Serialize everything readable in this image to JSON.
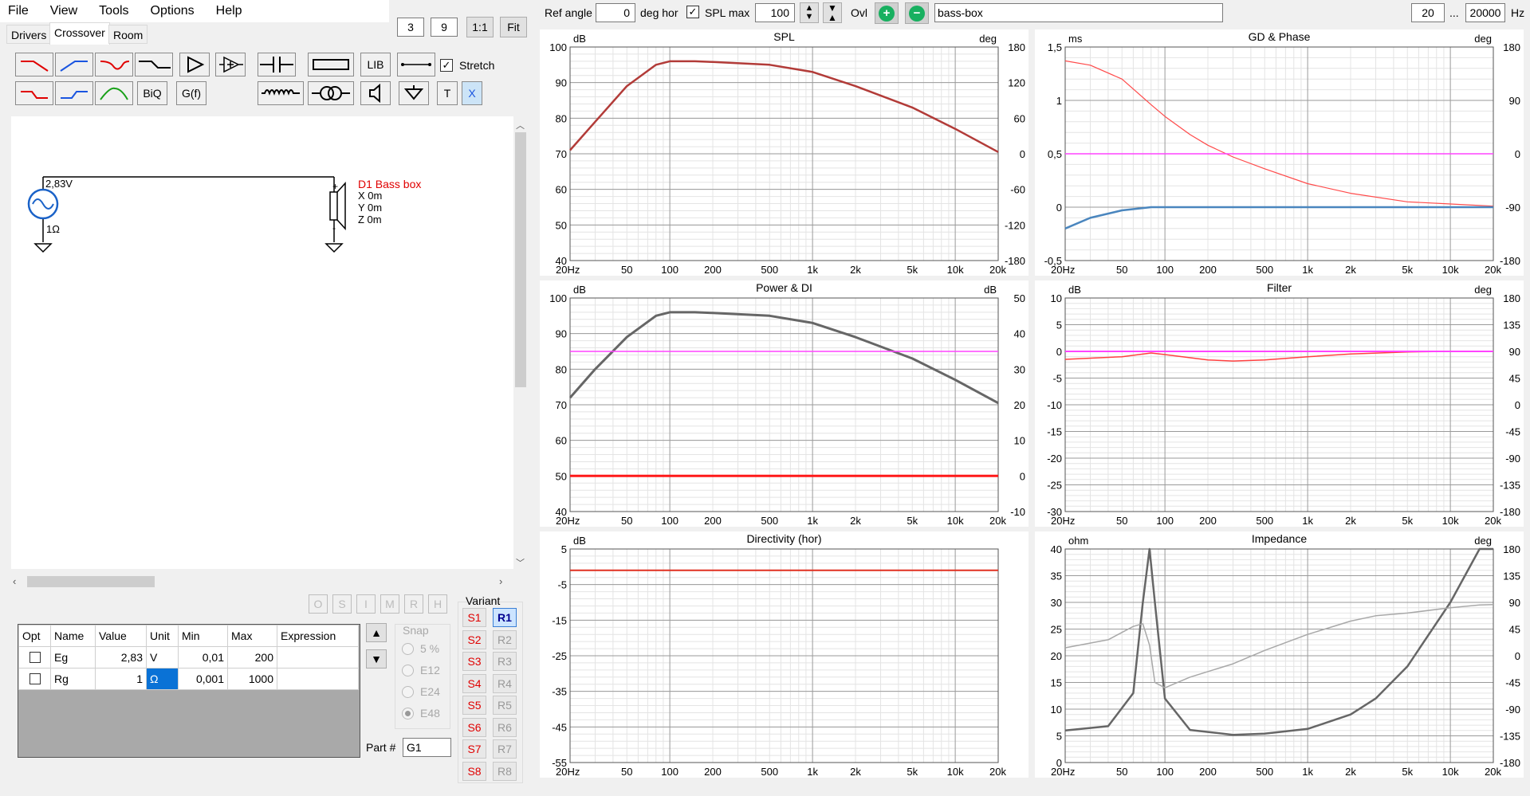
{
  "menu": [
    "File",
    "View",
    "Tools",
    "Options",
    "Help"
  ],
  "top": {
    "n1": "3",
    "n2": "9",
    "one": "1:1",
    "fit": "Fit"
  },
  "tabs": [
    "Drivers",
    "Crossover",
    "Room"
  ],
  "toolbar": {
    "lib": "LIB",
    "stretch": "Stretch",
    "biq": "BiQ",
    "gf": "G(f)",
    "t": "T",
    "x": "X"
  },
  "schematic": {
    "voltage": "2,83V",
    "resistance": "1Ω",
    "driver": "D1 Bass box",
    "x": "X 0m",
    "y": "Y 0m",
    "z": "Z 0m"
  },
  "graybtns": [
    "O",
    "S",
    "I",
    "M",
    "R",
    "H"
  ],
  "table": {
    "headers": [
      "Opt",
      "Name",
      "Value",
      "Unit",
      "Min",
      "Max",
      "Expression"
    ],
    "rows": [
      [
        "",
        "Eg",
        "2,83",
        "V",
        "0,01",
        "200",
        ""
      ],
      [
        "",
        "Rg",
        "1",
        "Ω",
        "0,001",
        "1000",
        ""
      ]
    ]
  },
  "snap": {
    "label": "Snap",
    "options": [
      "5 %",
      "E12",
      "E24",
      "E48"
    ]
  },
  "variant": {
    "label": "Variant",
    "s": [
      "S1",
      "S2",
      "S3",
      "S4",
      "S5",
      "S6",
      "S7",
      "S8"
    ],
    "r": [
      "R1",
      "R2",
      "R3",
      "R4",
      "R5",
      "R6",
      "R7",
      "R8"
    ]
  },
  "part": {
    "label": "Part #",
    "value": "G1"
  },
  "hdr": {
    "ref_label": "Ref angle",
    "ref_value": "0",
    "deg_hor": "deg hor",
    "spl_max_label": "SPL max",
    "spl_max_value": "100",
    "ovl": "Ovl",
    "name": "bass-box",
    "f_min": "20",
    "dots": "...",
    "f_max": "20000",
    "hz": "Hz"
  },
  "xticks": [
    "20Hz",
    "50",
    "100",
    "200",
    "500",
    "1k",
    "2k",
    "5k",
    "10k",
    "20k"
  ],
  "charts": {
    "spl": {
      "title": "SPL",
      "lunit": "dB",
      "runit": "deg",
      "ly": [
        "100",
        "90",
        "80",
        "70",
        "60",
        "50",
        "40"
      ],
      "ry": [
        "180",
        "120",
        "60",
        "0",
        "-60",
        "-120",
        "-180"
      ]
    },
    "gd": {
      "title": "GD & Phase",
      "lunit": "ms",
      "runit": "deg",
      "ly": [
        "1,5",
        "1",
        "0,5",
        "0",
        "-0,5"
      ],
      "ry": [
        "180",
        "90",
        "0",
        "-90",
        "-180"
      ]
    },
    "power": {
      "title": "Power & DI",
      "lunit": "dB",
      "runit": "dB",
      "ly": [
        "100",
        "90",
        "80",
        "70",
        "60",
        "50",
        "40"
      ],
      "ry": [
        "50",
        "40",
        "30",
        "20",
        "10",
        "0",
        "-10"
      ]
    },
    "filter": {
      "title": "Filter",
      "lunit": "dB",
      "runit": "deg",
      "ly": [
        "10",
        "5",
        "0",
        "-5",
        "-10",
        "-15",
        "-20",
        "-25",
        "-30"
      ],
      "ry": [
        "180",
        "135",
        "90",
        "45",
        "0",
        "-45",
        "-90",
        "-135",
        "-180"
      ]
    },
    "dir": {
      "title": "Directivity (hor)",
      "lunit": "dB",
      "runit": "",
      "ly": [
        "5",
        "-5",
        "-15",
        "-25",
        "-35",
        "-45",
        "-55"
      ],
      "ry": []
    },
    "imp": {
      "title": "Impedance",
      "lunit": "ohm",
      "runit": "deg",
      "ly": [
        "40",
        "35",
        "30",
        "25",
        "20",
        "15",
        "10",
        "5",
        "0"
      ],
      "ry": [
        "180",
        "135",
        "90",
        "45",
        "0",
        "-45",
        "-90",
        "-135",
        "-180"
      ]
    }
  },
  "chart_data": [
    {
      "type": "line",
      "title": "SPL",
      "x": [
        20,
        30,
        50,
        80,
        100,
        150,
        200,
        500,
        1000,
        2000,
        5000,
        10000,
        20000
      ],
      "series": [
        {
          "values": [
            71,
            79,
            89,
            95,
            96,
            96,
            95.8,
            95,
            93,
            89,
            83,
            77,
            70.5
          ]
        }
      ],
      "xlim": [
        20,
        20000
      ],
      "ylim": [
        40,
        100
      ],
      "xscale": "log"
    },
    {
      "type": "line",
      "title": "GD & Phase",
      "x": [
        20,
        30,
        50,
        80,
        100,
        150,
        200,
        300,
        500,
        1000,
        2000,
        5000,
        10000,
        20000
      ],
      "series": [
        {
          "values": [
            1.37,
            1.33,
            1.2,
            0.96,
            0.85,
            0.68,
            0.58,
            0.47,
            0.36,
            0.22,
            0.13,
            0.05,
            0.03,
            0.01
          ]
        },
        {
          "values": [
            -0.2,
            -0.1,
            -0.03,
            0,
            0,
            0,
            0,
            0,
            0,
            0,
            0,
            0,
            0,
            0
          ]
        },
        {
          "values": [
            0.5,
            0.5,
            0.5,
            0.5,
            0.5,
            0.5,
            0.5,
            0.5,
            0.5,
            0.5,
            0.5,
            0.5,
            0.5,
            0.5
          ]
        }
      ],
      "xlim": [
        20,
        20000
      ],
      "ylim": [
        -0.5,
        1.5
      ],
      "xscale": "log"
    },
    {
      "type": "line",
      "title": "Power & DI",
      "x": [
        20,
        30,
        50,
        80,
        100,
        150,
        200,
        500,
        1000,
        2000,
        5000,
        10000,
        20000
      ],
      "series": [
        {
          "values": [
            72,
            80,
            89,
            95,
            96,
            96,
            95.8,
            95,
            93,
            89,
            83,
            77,
            70.5
          ]
        },
        {
          "values": [
            85,
            85,
            85,
            85,
            85,
            85,
            85,
            85,
            85,
            85,
            85,
            85,
            85
          ]
        },
        {
          "values": [
            50,
            50,
            50,
            50,
            50,
            50,
            50,
            50,
            50,
            50,
            50,
            50,
            50
          ]
        }
      ],
      "xlim": [
        20,
        20000
      ],
      "ylim": [
        40,
        100
      ],
      "xscale": "log"
    },
    {
      "type": "line",
      "title": "Filter",
      "x": [
        20,
        50,
        80,
        100,
        200,
        300,
        500,
        1000,
        2000,
        5000,
        10000,
        20000
      ],
      "series": [
        {
          "values": [
            -1.5,
            -1,
            -0.3,
            -0.6,
            -1.6,
            -1.8,
            -1.6,
            -1,
            -0.5,
            -0.1,
            0,
            0
          ]
        },
        {
          "values": [
            0,
            0,
            0,
            0,
            0,
            0,
            0,
            0,
            0,
            0,
            0,
            0
          ]
        }
      ],
      "xlim": [
        20,
        20000
      ],
      "ylim": [
        -30,
        10
      ],
      "xscale": "log"
    },
    {
      "type": "line",
      "title": "Directivity (hor)",
      "x": [
        20,
        20000
      ],
      "series": [
        {
          "values": [
            -1,
            -1
          ]
        }
      ],
      "xlim": [
        20,
        20000
      ],
      "ylim": [
        -55,
        5
      ],
      "xscale": "log"
    },
    {
      "type": "line",
      "title": "Impedance",
      "x": [
        20,
        40,
        60,
        70,
        78,
        85,
        100,
        150,
        300,
        500,
        1000,
        2000,
        3000,
        5000,
        10000,
        16000,
        20000
      ],
      "series": [
        {
          "values": [
            6,
            6.8,
            13,
            30,
            40,
            30,
            12,
            6.1,
            5.2,
            5.4,
            6.3,
            9,
            12,
            18,
            30,
            40,
            40
          ]
        },
        {
          "values": [
            21.5,
            23,
            25.5,
            26,
            22,
            15,
            14,
            16,
            18.5,
            21,
            24,
            26.5,
            27.5,
            28,
            29,
            29.5,
            29.6
          ]
        }
      ],
      "xlim": [
        20,
        20000
      ],
      "ylim": [
        0,
        40
      ],
      "xscale": "log"
    }
  ]
}
